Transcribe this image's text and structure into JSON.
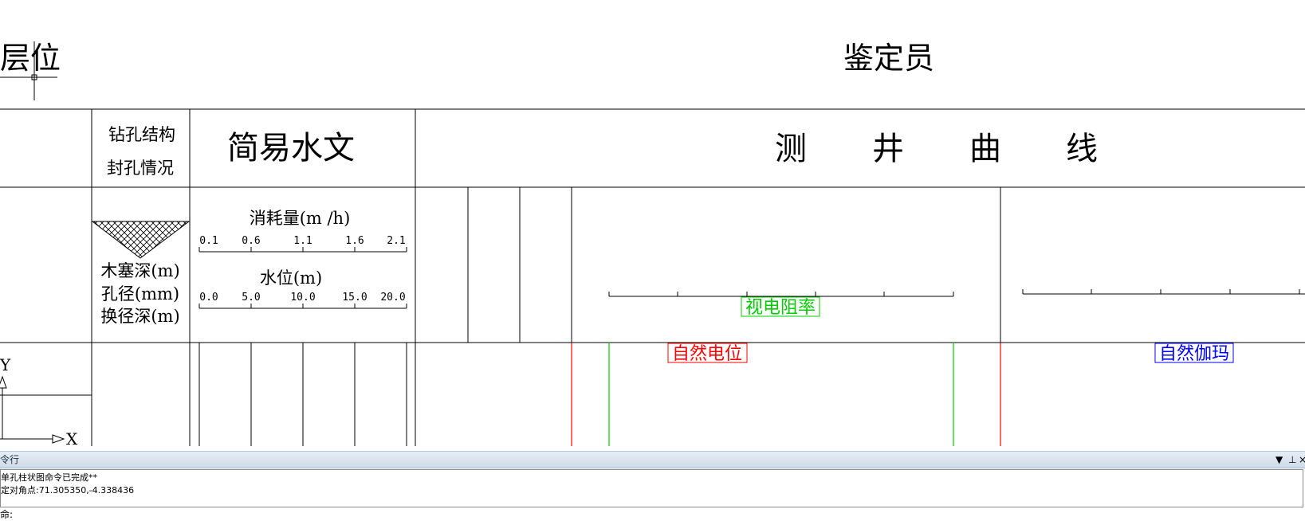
{
  "header": {
    "layer_partial": "层位",
    "appraiser": "鉴定员"
  },
  "table": {
    "col_drill_structure": "钻孔结构",
    "col_seal_status": "封孔情况",
    "col_hydrology": "简易水文",
    "col_logging_curve_chars": [
      "测",
      "井",
      "曲",
      "线"
    ],
    "consumption_label": "消耗量(m /h)",
    "consumption_ticks": [
      "0.1",
      "0.6",
      "1.1",
      "1.6",
      "2.1"
    ],
    "water_level_label": "水位(m)",
    "water_level_ticks": [
      "0.0",
      "5.0",
      "10.0",
      "15.0",
      "20.0"
    ],
    "plug_depth": "木塞深(m)",
    "hole_diameter": "孔径(mm)",
    "change_diameter_depth": "换径深(m)"
  },
  "curves": {
    "apparent_resistivity": "视电阻率",
    "spontaneous_potential": "自然电位",
    "natural_gamma": "自然伽玛",
    "colors": {
      "resistivity": "#00cc00",
      "potential": "#ff0000",
      "gamma": "#0000ff"
    }
  },
  "axes": {
    "y": "Y",
    "x": "X"
  },
  "command_panel": {
    "title": "命令行",
    "title_visible": "令行",
    "history": [
      "单孔柱状图命令已完成**",
      "定对角点:71.305350,-4.338436"
    ],
    "prompt": "命:"
  }
}
